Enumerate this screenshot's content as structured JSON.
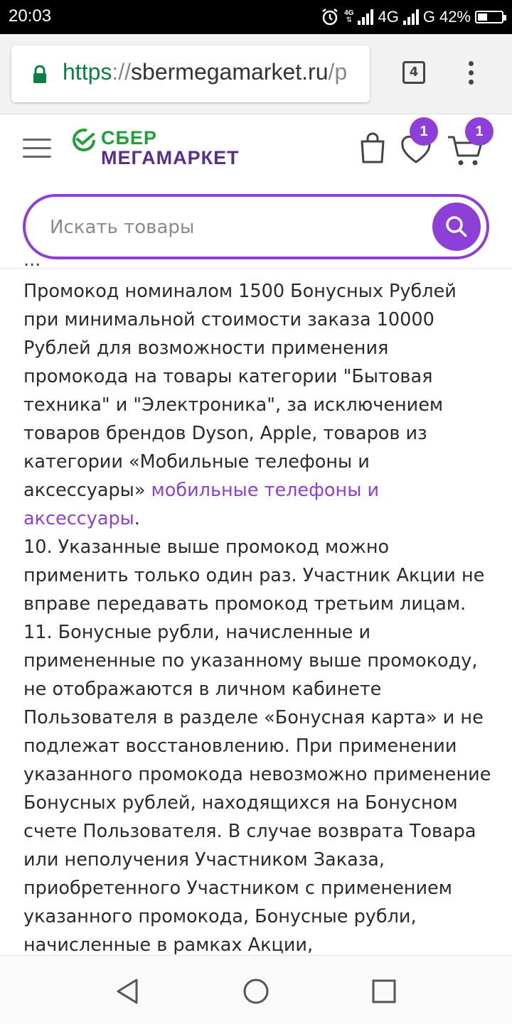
{
  "status_bar": {
    "time": "20:03",
    "network_1": "4G",
    "network_2": "G",
    "battery": "42%",
    "battery_level": 0.42
  },
  "browser": {
    "url_scheme": "https",
    "url_separator": "://",
    "url_host": "sbermegamarket.ru",
    "url_path": "/p",
    "tab_count": "4"
  },
  "site": {
    "logo_line1": "СБЕР",
    "logo_line2": "МЕГАМАРКЕТ",
    "favorites_count": "1",
    "cart_count": "1",
    "search_placeholder": "Искать товары"
  },
  "content": {
    "cut_line": "... ",
    "p1": "Промокод номиналом 1500 Бонусных Рублей при минимальной стоимости заказа 10000 Рублей для возможности применения промокода на товары категории \"Бытовая техника\" и \"Электроника\", за исключением товаров брендов Dyson, Apple, товаров из категории «Мобильные телефоны и аксессуары» ",
    "p1_link": "мобильные телефоны и аксессуары",
    "p1_end": ".",
    "p2": "10. Указанные выше промокод можно применить только один раз. Участник Акции не вправе передавать промокод третьим лицам.",
    "p3": "11. Бонусные рубли, начисленные и примененные по указанному выше промокоду, не отображаются в личном кабинете Пользователя в разделе «Бонусная карта» и не подлежат восстановлению. При применении указанного промокода невозможно применение Бонусных рублей, находящихся на Бонусном счете Пользователя. В случае возврата Товара или неполучения Участником Заказа, приобретенного Участником с применением указанного промокода, Бонусные рубли, начисленные в рамках Акции,"
  },
  "colors": {
    "accent": "#8d3fd7",
    "brand_green": "#21a038",
    "brand_purple": "#5b2d8e",
    "link": "#8d3fd7"
  }
}
